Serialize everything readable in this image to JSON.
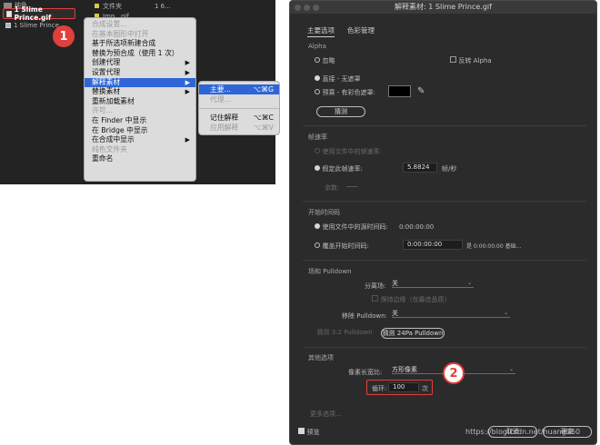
{
  "project": {
    "folder_label": "纯色",
    "rows": [
      {
        "icon": "folder",
        "label": "纯色"
      },
      {
        "icon": "file",
        "label": "1 Slime Prince.gif"
      },
      {
        "icon": "comp",
        "label": "1 Slime Prince"
      }
    ],
    "col_labels": [
      "文件夹",
      "Imp...gif",
      "1 6..."
    ],
    "selected_file": "1 Slime Prince.gif",
    "step1": "1"
  },
  "context_menu": {
    "items": [
      {
        "label": "合成设置...",
        "disabled": true
      },
      {
        "label": "在基本图形中打开",
        "disabled": true
      },
      {
        "label": "基于所选项新建合成",
        "disabled": false
      },
      {
        "label": "替换为预合成（使用 1 次）",
        "disabled": false
      },
      {
        "label": "创建代理",
        "disabled": false,
        "submenu": true
      },
      {
        "label": "设置代理",
        "disabled": false,
        "submenu": true
      },
      {
        "label": "解释素材",
        "disabled": false,
        "submenu": true,
        "highlighted": true
      },
      {
        "label": "替换素材",
        "disabled": false,
        "submenu": true
      },
      {
        "label": "重新加载素材",
        "disabled": false
      },
      {
        "label": "许可...",
        "disabled": true
      },
      {
        "label": "在 Finder 中显示",
        "disabled": false
      },
      {
        "label": "在 Bridge 中显示",
        "disabled": false
      },
      {
        "label": "在合成中显示",
        "disabled": false,
        "submenu": true
      },
      {
        "label": "纯色文件夹",
        "disabled": true
      },
      {
        "label": "重命名",
        "disabled": false
      }
    ],
    "arrow": "▶"
  },
  "submenu": {
    "main": {
      "label": "主要...",
      "shortcut": "⌥⌘G"
    },
    "proxy": {
      "label": "代理..."
    },
    "remember": {
      "label": "记住解释",
      "shortcut": "⌥⌘C"
    },
    "apply": {
      "label": "应用解释",
      "shortcut": "⌥⌘V"
    }
  },
  "dialog": {
    "title": "解释素材: 1 Slime Prince.gif",
    "tabs": [
      "主要选项",
      "色彩管理"
    ],
    "alpha": {
      "section": "Alpha",
      "ignore": "忽略",
      "invert": "反转 Alpha",
      "straight": "直接 - 无遮罩",
      "premult": "预乘 - 有彩色遮罩:",
      "guess": "猜测"
    },
    "framerate": {
      "section": "帧速率",
      "use_file": "使用文件中的帧速率:",
      "assume": "假定此帧速率:",
      "value": "5.8824",
      "unit": "帧/秒",
      "remaining": "余数:"
    },
    "start_timecode": {
      "section": "开始时间码",
      "use_file": "使用文件中的源时间码:",
      "use_file_value": "0:00:00:00",
      "override": "覆盖开始时间码:",
      "override_value": "0:00:00:00",
      "base": "是 0:00:00:00 基础..."
    },
    "fields": {
      "section": "场和 Pulldown",
      "separate": "分离场:",
      "separate_value": "关",
      "preserve": "保持边缘（仅最佳品质）",
      "remove_pulldown": "移除 Pulldown:",
      "remove_value": "关",
      "guess_32": "猜测 3:2 Pulldown",
      "guess_24pa": "猜测 24Pa Pulldown"
    },
    "other": {
      "section": "其他选项",
      "pixel_aspect": "像素长宽比:",
      "pixel_value": "方形像素",
      "loop_label": "循环:",
      "loop_value": "100",
      "loop_unit": "次",
      "more": "更多选项..."
    },
    "preview": "预览",
    "cancel": "取消",
    "ok": "确定",
    "step2": "2"
  },
  "watermark": "https://blog.csdn.net/huang360",
  "colors": {
    "accent": "#2e66d6",
    "callout": "#e0403a"
  }
}
